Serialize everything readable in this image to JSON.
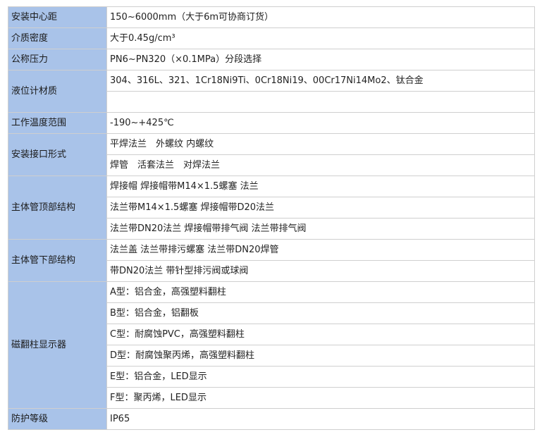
{
  "rows": [
    {
      "label": "安装中心距",
      "values": [
        "150~6000mm（大于6m可协商订货）"
      ]
    },
    {
      "label": "介质密度",
      "values": [
        "大于0.45g/cm³"
      ]
    },
    {
      "label": "公称压力",
      "values": [
        "PN6~PN320（×0.1MPa）分段选择"
      ]
    },
    {
      "label": "液位计材质",
      "values": [
        "304、316L、321、1Cr18Ni9Ti、0Cr18Ni19、00Cr17Ni14Mo2、钛合金",
        ""
      ]
    },
    {
      "label": "工作温度范围",
      "values": [
        "-190~+425℃"
      ]
    },
    {
      "label": "安装接口形式",
      "values": [
        "平焊法兰　外螺纹  内螺纹",
        "焊管　活套法兰　对焊法兰"
      ]
    },
    {
      "label": "主体管顶部结构",
      "values": [
        "焊接帽  焊接帽带M14×1.5螺塞  法兰",
        "法兰带M14×1.5螺塞  焊接帽带D20法兰",
        "法兰带DN20法兰  焊接帽带排气阀  法兰带排气阀"
      ]
    },
    {
      "label": "主体管下部结构",
      "values": [
        "法兰盖  法兰带排污螺塞  法兰带DN20焊管",
        "带DN20法兰  带针型排污阀或球阀"
      ]
    },
    {
      "label": "磁翻柱显示器",
      "values": [
        "A型：铝合金，高强塑料翻柱",
        "B型：铝合金，铝翻板",
        "C型：耐腐蚀PVC，高强塑料翻柱",
        "D型：耐腐蚀聚丙烯，高强塑料翻柱",
        "E型：铝合金，LED显示",
        "F型：聚丙烯，LED显示"
      ]
    },
    {
      "label": "防护等级",
      "values": [
        "IP65"
      ]
    }
  ]
}
